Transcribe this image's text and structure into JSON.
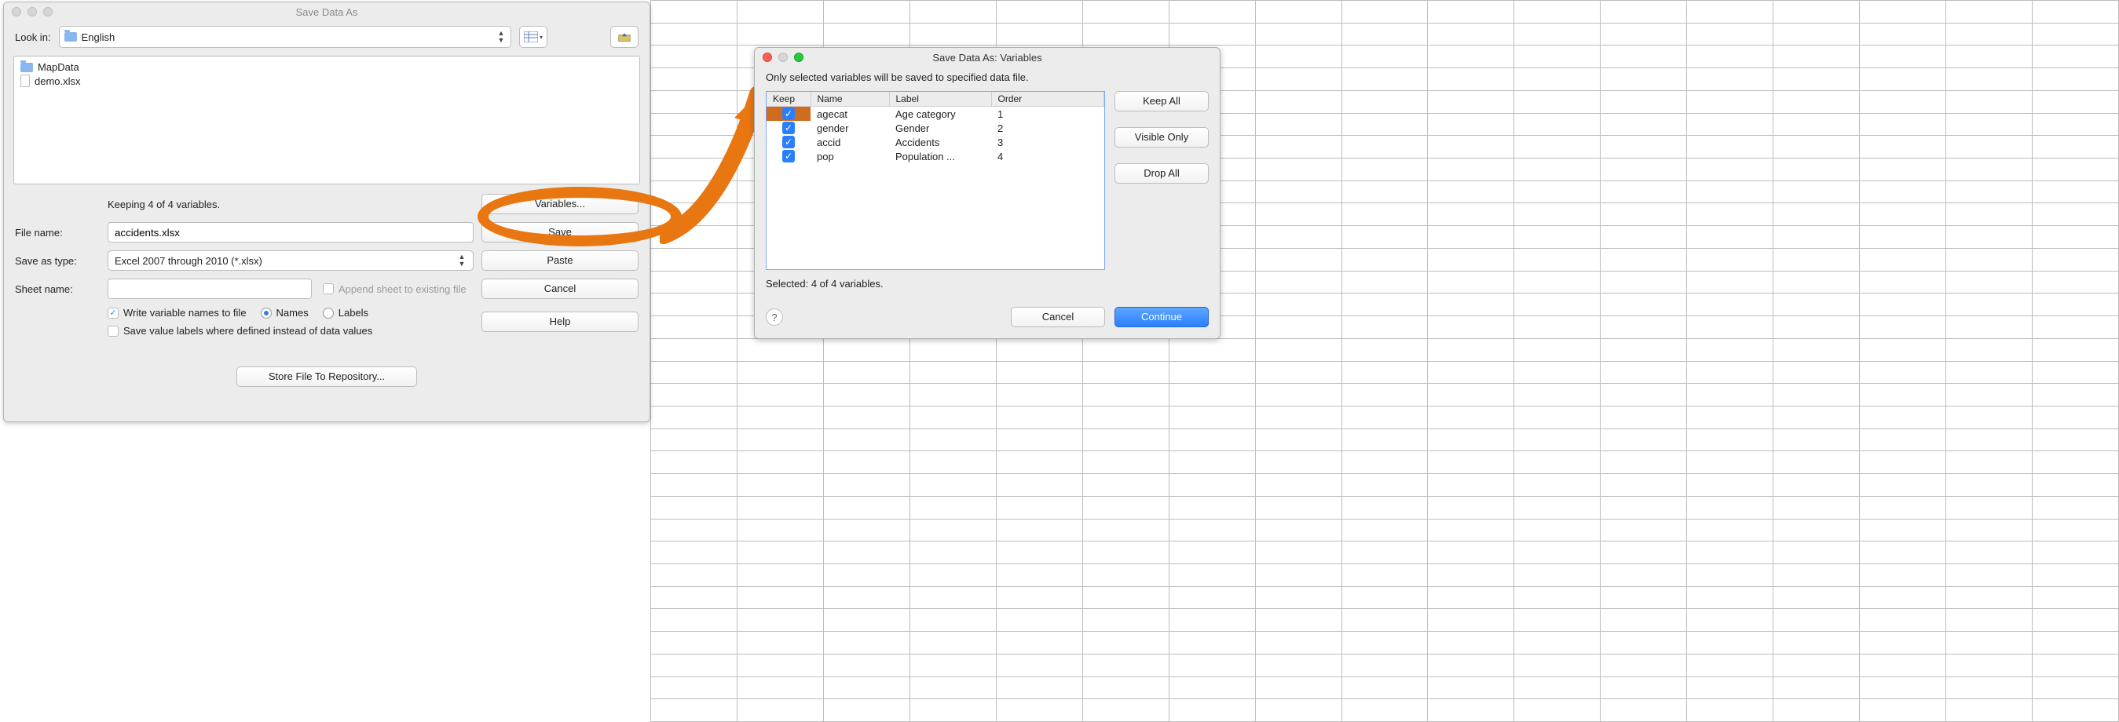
{
  "save_dialog": {
    "title": "Save Data As",
    "look_in_label": "Look in:",
    "path_folder": "English",
    "files": [
      {
        "name": "MapData",
        "type": "folder"
      },
      {
        "name": "demo.xlsx",
        "type": "file"
      }
    ],
    "keeping": "Keeping 4 of 4 variables.",
    "file_name_label": "File name:",
    "file_name_value": "accidents.xlsx",
    "save_as_type_label": "Save as type:",
    "save_as_type_value": "Excel 2007 through 2010 (*.xlsx)",
    "sheet_name_label": "Sheet name:",
    "sheet_name_value": "",
    "append_label": "Append sheet to existing file",
    "write_names_label": "Write variable names to file",
    "names_radio": "Names",
    "labels_radio": "Labels",
    "save_value_labels_label": "Save value labels where defined instead of data values",
    "variables_button": "Variables...",
    "save_button": "Save",
    "paste_button": "Paste",
    "cancel_button": "Cancel",
    "help_button": "Help",
    "store_repo_button": "Store File To Repository..."
  },
  "vars_dialog": {
    "title": "Save Data As: Variables",
    "instruction": "Only selected variables will be saved to specified data file.",
    "columns": {
      "keep": "Keep",
      "name": "Name",
      "label": "Label",
      "order": "Order"
    },
    "rows": [
      {
        "keep": true,
        "name": "agecat",
        "label": "Age category",
        "order": "1",
        "selected": true
      },
      {
        "keep": true,
        "name": "gender",
        "label": "Gender",
        "order": "2",
        "selected": false
      },
      {
        "keep": true,
        "name": "accid",
        "label": "Accidents",
        "order": "3",
        "selected": false
      },
      {
        "keep": true,
        "name": "pop",
        "label": "Population ...",
        "order": "4",
        "selected": false
      }
    ],
    "keep_all": "Keep All",
    "visible_only": "Visible Only",
    "drop_all": "Drop All",
    "selected_line": "Selected: 4 of 4 variables.",
    "cancel": "Cancel",
    "continue": "Continue"
  }
}
